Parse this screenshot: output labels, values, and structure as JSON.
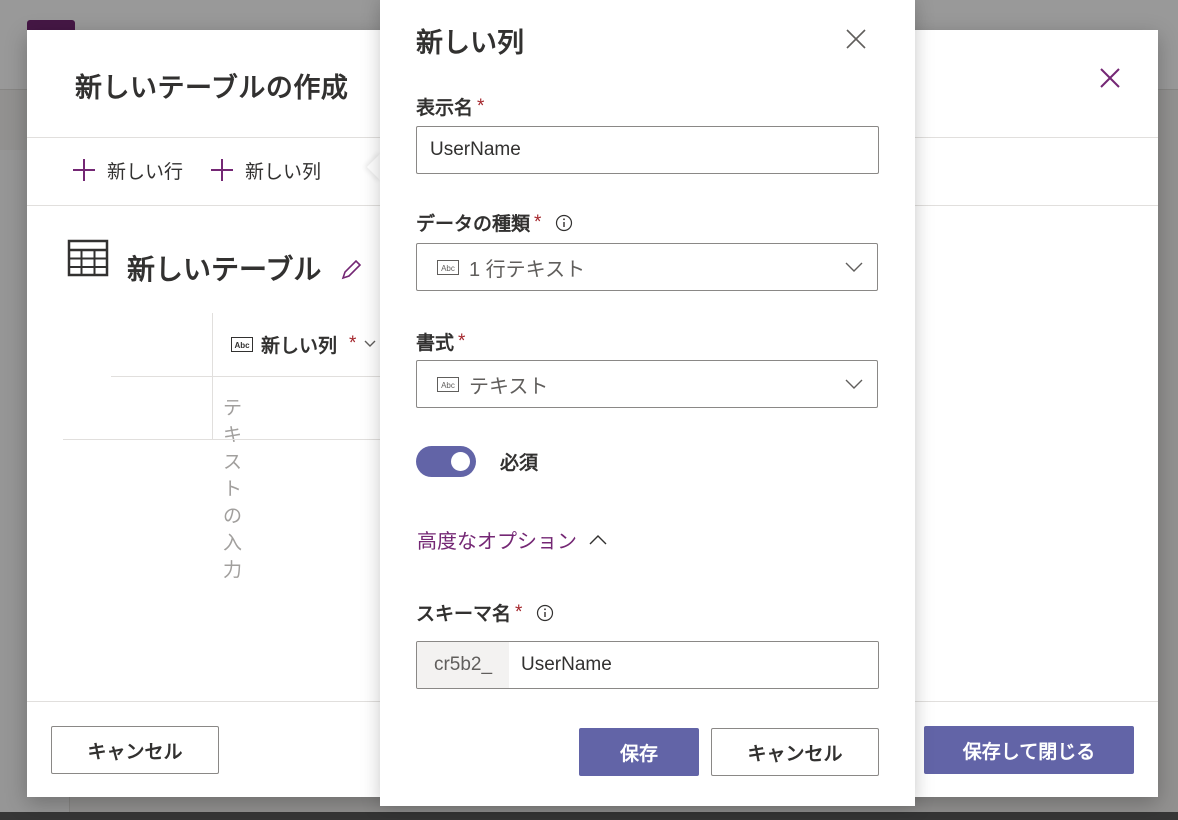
{
  "outer_dialog": {
    "title": "新しいテーブルの作成",
    "commands": {
      "new_row": "新しい行",
      "new_column": "新しい列"
    },
    "table_title": "新しいテーブル",
    "column_header": "新しい列",
    "required_mark": "*",
    "cell_placeholder": "テキストの入力",
    "cancel_label": "キャンセル",
    "save_close_label": "保存して閉じる"
  },
  "panel": {
    "title": "新しい列",
    "display_name": {
      "label": "表示名",
      "required": "*",
      "value": "UserName"
    },
    "data_type": {
      "label": "データの種類",
      "required": "*",
      "value": "1 行テキスト",
      "icon": "abc-text-icon"
    },
    "format": {
      "label": "書式",
      "required": "*",
      "value": "テキスト",
      "icon": "abc-text-icon"
    },
    "required_toggle": {
      "label": "必須",
      "on": true
    },
    "advanced_options": "高度なオプション",
    "schema_name": {
      "label": "スキーマ名",
      "required": "*",
      "prefix": "cr5b2_",
      "value": "UserName"
    },
    "save_label": "保存",
    "cancel_label": "キャンセル"
  },
  "colors": {
    "accent": "#6264a7",
    "link": "#742774",
    "required": "#a4262c"
  }
}
